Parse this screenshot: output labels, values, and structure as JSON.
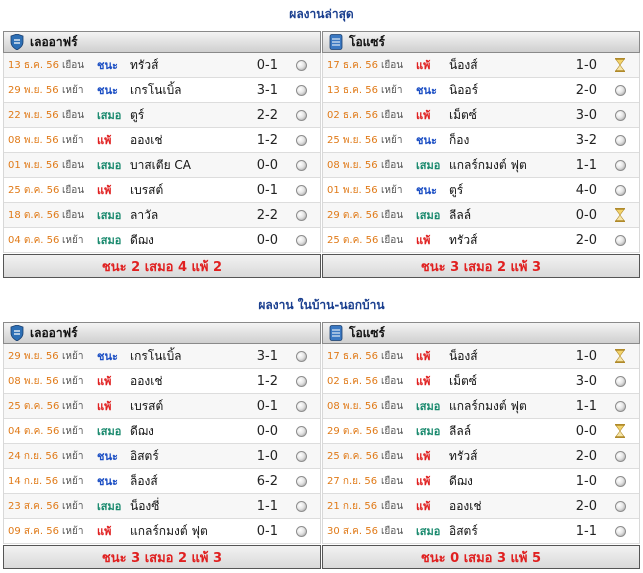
{
  "sections": [
    {
      "title": "ผลงานล่าสุด",
      "panels": [
        {
          "team": "เลออาฟร์",
          "summary": "ชนะ 2 เสมอ 4 แพ้ 2",
          "matches": [
            {
              "date": "13 ธ.ค. 56",
              "venue": "เยือน",
              "result": "ชนะ",
              "opponent": "ทรัวส์",
              "score": "0-1",
              "icon": "ball"
            },
            {
              "date": "29 พ.ย. 56",
              "venue": "เหย้า",
              "result": "ชนะ",
              "opponent": "เกรโนเบิ้ล",
              "score": "3-1",
              "icon": "ball"
            },
            {
              "date": "22 พ.ย. 56",
              "venue": "เยือน",
              "result": "เสมอ",
              "opponent": "ตูร์",
              "score": "2-2",
              "icon": "ball"
            },
            {
              "date": "08 พ.ย. 56",
              "venue": "เหย้า",
              "result": "แพ้",
              "opponent": "อองเช่",
              "score": "1-2",
              "icon": "ball"
            },
            {
              "date": "01 พ.ย. 56",
              "venue": "เยือน",
              "result": "เสมอ",
              "opponent": "บาสเตีย CA",
              "score": "0-0",
              "icon": "ball"
            },
            {
              "date": "25 ต.ค. 56",
              "venue": "เยือน",
              "result": "แพ้",
              "opponent": "เบรสต์",
              "score": "0-1",
              "icon": "ball"
            },
            {
              "date": "18 ต.ค. 56",
              "venue": "เยือน",
              "result": "เสมอ",
              "opponent": "ลาวัล",
              "score": "2-2",
              "icon": "ball"
            },
            {
              "date": "04 ต.ค. 56",
              "venue": "เหย้า",
              "result": "เสมอ",
              "opponent": "ดีฌง",
              "score": "0-0",
              "icon": "ball"
            }
          ]
        },
        {
          "team": "โอแซร์",
          "summary": "ชนะ 3 เสมอ 2 แพ้ 3",
          "matches": [
            {
              "date": "17 ธ.ค. 56",
              "venue": "เยือน",
              "result": "แพ้",
              "opponent": "น็องส์",
              "score": "1-0",
              "icon": "hourglass"
            },
            {
              "date": "13 ธ.ค. 56",
              "venue": "เหย้า",
              "result": "ชนะ",
              "opponent": "นิออร์",
              "score": "2-0",
              "icon": "ball"
            },
            {
              "date": "02 ธ.ค. 56",
              "venue": "เยือน",
              "result": "แพ้",
              "opponent": "เม็ตซ์",
              "score": "3-0",
              "icon": "ball"
            },
            {
              "date": "25 พ.ย. 56",
              "venue": "เหย้า",
              "result": "ชนะ",
              "opponent": "ก็อง",
              "score": "3-2",
              "icon": "ball"
            },
            {
              "date": "08 พ.ย. 56",
              "venue": "เยือน",
              "result": "เสมอ",
              "opponent": "แกลร์กมงต์ ฟุต",
              "score": "1-1",
              "icon": "ball"
            },
            {
              "date": "01 พ.ย. 56",
              "venue": "เหย้า",
              "result": "ชนะ",
              "opponent": "ตูร์",
              "score": "4-0",
              "icon": "ball"
            },
            {
              "date": "29 ต.ค. 56",
              "venue": "เยือน",
              "result": "เสมอ",
              "opponent": "ลีลล์",
              "score": "0-0",
              "icon": "hourglass"
            },
            {
              "date": "25 ต.ค. 56",
              "venue": "เยือน",
              "result": "แพ้",
              "opponent": "ทรัวส์",
              "score": "2-0",
              "icon": "ball"
            }
          ]
        }
      ]
    },
    {
      "title": "ผลงาน ในบ้าน-นอกบ้าน",
      "panels": [
        {
          "team": "เลออาฟร์",
          "summary": "ชนะ 3 เสมอ 2 แพ้ 3",
          "matches": [
            {
              "date": "29 พ.ย. 56",
              "venue": "เหย้า",
              "result": "ชนะ",
              "opponent": "เกรโนเบิ้ล",
              "score": "3-1",
              "icon": "ball"
            },
            {
              "date": "08 พ.ย. 56",
              "venue": "เหย้า",
              "result": "แพ้",
              "opponent": "อองเช่",
              "score": "1-2",
              "icon": "ball"
            },
            {
              "date": "25 ต.ค. 56",
              "venue": "เหย้า",
              "result": "แพ้",
              "opponent": "เบรสต์",
              "score": "0-1",
              "icon": "ball"
            },
            {
              "date": "04 ต.ค. 56",
              "venue": "เหย้า",
              "result": "เสมอ",
              "opponent": "ดีฌง",
              "score": "0-0",
              "icon": "ball"
            },
            {
              "date": "24 ก.ย. 56",
              "venue": "เหย้า",
              "result": "ชนะ",
              "opponent": "อิสตร์",
              "score": "1-0",
              "icon": "ball"
            },
            {
              "date": "14 ก.ย. 56",
              "venue": "เหย้า",
              "result": "ชนะ",
              "opponent": "ล็องส์",
              "score": "6-2",
              "icon": "ball"
            },
            {
              "date": "23 ส.ค. 56",
              "venue": "เหย้า",
              "result": "เสมอ",
              "opponent": "น็องซี่",
              "score": "1-1",
              "icon": "ball"
            },
            {
              "date": "09 ส.ค. 56",
              "venue": "เหย้า",
              "result": "แพ้",
              "opponent": "แกลร์กมงต์ ฟุต",
              "score": "0-1",
              "icon": "ball"
            }
          ]
        },
        {
          "team": "โอแซร์",
          "summary": "ชนะ 0 เสมอ 3 แพ้ 5",
          "matches": [
            {
              "date": "17 ธ.ค. 56",
              "venue": "เยือน",
              "result": "แพ้",
              "opponent": "น็องส์",
              "score": "1-0",
              "icon": "hourglass"
            },
            {
              "date": "02 ธ.ค. 56",
              "venue": "เยือน",
              "result": "แพ้",
              "opponent": "เม็ตซ์",
              "score": "3-0",
              "icon": "ball"
            },
            {
              "date": "08 พ.ย. 56",
              "venue": "เยือน",
              "result": "เสมอ",
              "opponent": "แกลร์กมงต์ ฟุต",
              "score": "1-1",
              "icon": "ball"
            },
            {
              "date": "29 ต.ค. 56",
              "venue": "เยือน",
              "result": "เสมอ",
              "opponent": "ลีลล์",
              "score": "0-0",
              "icon": "hourglass"
            },
            {
              "date": "25 ต.ค. 56",
              "venue": "เยือน",
              "result": "แพ้",
              "opponent": "ทรัวส์",
              "score": "2-0",
              "icon": "ball"
            },
            {
              "date": "27 ก.ย. 56",
              "venue": "เยือน",
              "result": "แพ้",
              "opponent": "ดีฌง",
              "score": "1-0",
              "icon": "ball"
            },
            {
              "date": "21 ก.ย. 56",
              "venue": "เยือน",
              "result": "แพ้",
              "opponent": "อองเช่",
              "score": "2-0",
              "icon": "ball"
            },
            {
              "date": "30 ส.ค. 56",
              "venue": "เยือน",
              "result": "เสมอ",
              "opponent": "อิสตร์",
              "score": "1-1",
              "icon": "ball"
            }
          ]
        }
      ]
    }
  ],
  "colors": {
    "title": "#1a3f8f",
    "date": "#e07a18",
    "win": "#1c4fc4",
    "draw": "#1a8a6e",
    "lose": "#e02020",
    "summary": "#e02020"
  },
  "icons": {
    "ball": "football-icon",
    "hourglass": "hourglass-icon"
  }
}
